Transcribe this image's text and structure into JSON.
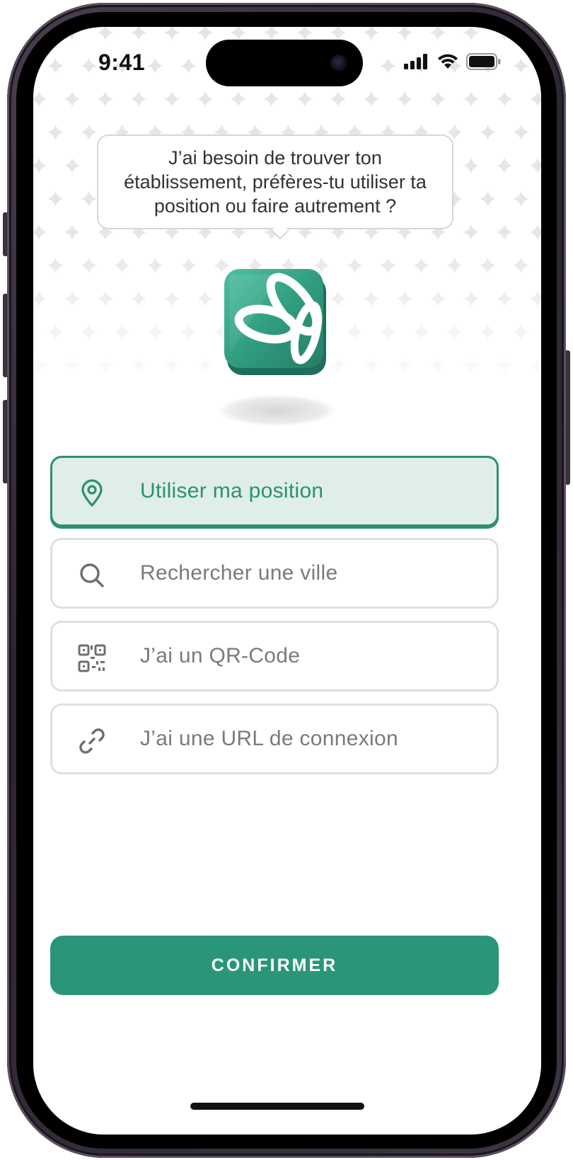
{
  "status_bar": {
    "time": "9:41",
    "signal_icon": "cellular-signal-icon",
    "wifi_icon": "wifi-icon",
    "battery_icon": "battery-icon"
  },
  "assistant": {
    "message": "J’ai besoin de trouver ton établissement, préfères-tu utiliser ta position ou faire autrement ?",
    "logo_icon": "app-logo-icon"
  },
  "options": [
    {
      "label": "Utiliser ma position",
      "icon": "location-pin-icon",
      "selected": true
    },
    {
      "label": "Rechercher une ville",
      "icon": "search-icon",
      "selected": false
    },
    {
      "label": "J’ai un QR-Code",
      "icon": "qr-code-icon",
      "selected": false
    },
    {
      "label": "J’ai une URL de connexion",
      "icon": "link-icon",
      "selected": false
    }
  ],
  "confirm_button": {
    "label": "CONFIRMER"
  },
  "colors": {
    "accent": "#2a9579",
    "accent_light_bg": "#dfeee9",
    "border": "#e0e0e0",
    "text_muted": "#7a7a7a"
  }
}
